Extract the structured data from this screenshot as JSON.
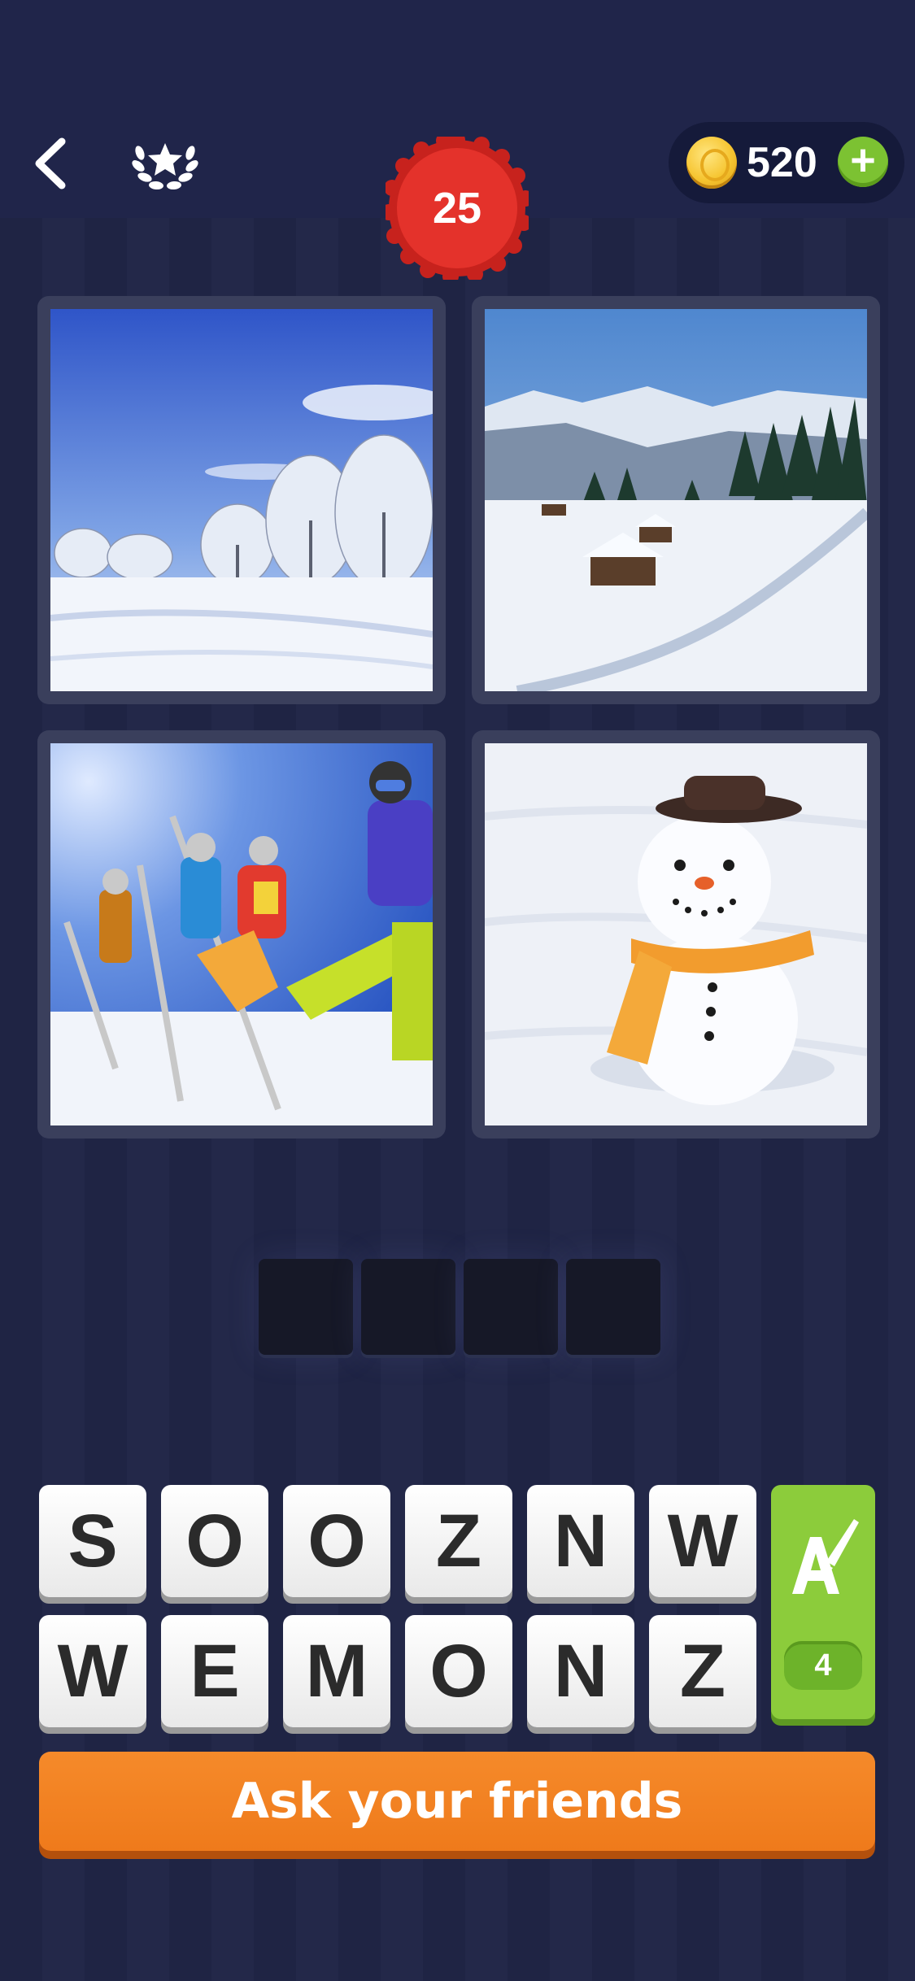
{
  "header": {
    "level": "25",
    "coins": "520",
    "plus_label": "+",
    "icons": [
      "back-chevron-icon",
      "laurel-star-icon",
      "level-badge-icon",
      "coin-icon",
      "plus-icon"
    ]
  },
  "puzzle": {
    "images": [
      {
        "subject": "snowy-trees-landscape"
      },
      {
        "subject": "snowy-mountain-cabins"
      },
      {
        "subject": "skiers-group"
      },
      {
        "subject": "snowman"
      }
    ],
    "answer_slots": 4
  },
  "letters": {
    "row1": [
      "S",
      "O",
      "O",
      "Z",
      "N",
      "W"
    ],
    "row2": [
      "W",
      "E",
      "M",
      "O",
      "N",
      "Z"
    ]
  },
  "hint": {
    "count": "4",
    "icon": "letter-brush-icon"
  },
  "ask_friends": {
    "label": "Ask your friends"
  },
  "colors": {
    "background": "#1e2342",
    "level_badge": "#e4322b",
    "coin_plus": "#7cc232",
    "hint_button": "#8ccc3b",
    "ask_button": "#f58a2a"
  }
}
